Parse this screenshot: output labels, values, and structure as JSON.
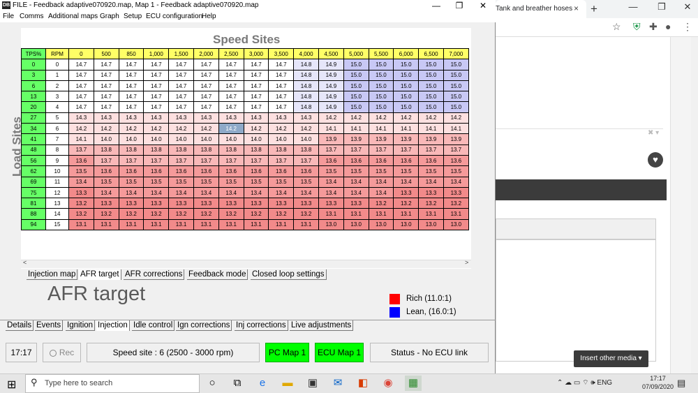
{
  "browser": {
    "tab_title": "Tank and breather hoses lo",
    "tab_close": "×",
    "new_tab": "+",
    "min": "—",
    "max": "❐",
    "close": "✕",
    "insert_media": "Insert other media ▾",
    "dropdown": "✖ ▾"
  },
  "app": {
    "title": "FILE - Feedback adaptive070920.map,  Map 1 - Feedback adaptive070920.map",
    "icon_text": "DB",
    "min": "—",
    "max": "❐",
    "close": "✕",
    "menu": [
      "File",
      "Comms",
      "Additional maps",
      "Graph",
      "Setup",
      "ECU configuration",
      "Help"
    ]
  },
  "map": {
    "speed_title": "Speed Sites",
    "load_title": "Load Sites",
    "corner_x": "TPS%",
    "corner_y": "RPM",
    "rpm_headers": [
      "0",
      "500",
      "850",
      "1,000",
      "1,500",
      "2,000",
      "2,500",
      "3,000",
      "3,500",
      "4,000",
      "4,500",
      "5,000",
      "5,500",
      "6,000",
      "6,500",
      "7,000"
    ],
    "tps": [
      "0",
      "3",
      "6",
      "13",
      "20",
      "27",
      "34",
      "41",
      "48",
      "56",
      "62",
      "69",
      "75",
      "81",
      "88",
      "94"
    ],
    "sites": [
      "0",
      "1",
      "2",
      "3",
      "4",
      "5",
      "6",
      "7",
      "8",
      "9",
      "10",
      "11",
      "12",
      "13",
      "14",
      "15"
    ],
    "values": [
      [
        "14.7",
        "14.7",
        "14.7",
        "14.7",
        "14.7",
        "14.7",
        "14.7",
        "14.7",
        "14.7",
        "14.8",
        "14.9",
        "15.0",
        "15.0",
        "15.0",
        "15.0",
        "15.0"
      ],
      [
        "14.7",
        "14.7",
        "14.7",
        "14.7",
        "14.7",
        "14.7",
        "14.7",
        "14.7",
        "14.7",
        "14.8",
        "14.9",
        "15.0",
        "15.0",
        "15.0",
        "15.0",
        "15.0"
      ],
      [
        "14.7",
        "14.7",
        "14.7",
        "14.7",
        "14.7",
        "14.7",
        "14.7",
        "14.7",
        "14.7",
        "14.8",
        "14.9",
        "15.0",
        "15.0",
        "15.0",
        "15.0",
        "15.0"
      ],
      [
        "14.7",
        "14.7",
        "14.7",
        "14.7",
        "14.7",
        "14.7",
        "14.7",
        "14.7",
        "14.7",
        "14.8",
        "14.9",
        "15.0",
        "15.0",
        "15.0",
        "15.0",
        "15.0"
      ],
      [
        "14.7",
        "14.7",
        "14.7",
        "14.7",
        "14.7",
        "14.7",
        "14.7",
        "14.7",
        "14.7",
        "14.8",
        "14.9",
        "15.0",
        "15.0",
        "15.0",
        "15.0",
        "15.0"
      ],
      [
        "14.3",
        "14.3",
        "14.3",
        "14.3",
        "14.3",
        "14.3",
        "14.3",
        "14.3",
        "14.3",
        "14.3",
        "14.2",
        "14.2",
        "14.2",
        "14.2",
        "14.2",
        "14.2"
      ],
      [
        "14.2",
        "14.2",
        "14.2",
        "14.2",
        "14.2",
        "14.2",
        "14.2",
        "14.2",
        "14.2",
        "14.2",
        "14.1",
        "14.1",
        "14.1",
        "14.1",
        "14.1",
        "14.1"
      ],
      [
        "14.1",
        "14.0",
        "14.0",
        "14.0",
        "14.0",
        "14.0",
        "14.0",
        "14.0",
        "14.0",
        "14.0",
        "13.9",
        "13.9",
        "13.9",
        "13.9",
        "13.9",
        "13.9"
      ],
      [
        "13.7",
        "13.8",
        "13.8",
        "13.8",
        "13.8",
        "13.8",
        "13.8",
        "13.8",
        "13.8",
        "13.8",
        "13.7",
        "13.7",
        "13.7",
        "13.7",
        "13.7",
        "13.7"
      ],
      [
        "13.6",
        "13.7",
        "13.7",
        "13.7",
        "13.7",
        "13.7",
        "13.7",
        "13.7",
        "13.7",
        "13.7",
        "13.6",
        "13.6",
        "13.6",
        "13.6",
        "13.6",
        "13.6"
      ],
      [
        "13.5",
        "13.6",
        "13.6",
        "13.6",
        "13.6",
        "13.6",
        "13.6",
        "13.6",
        "13.6",
        "13.6",
        "13.5",
        "13.5",
        "13.5",
        "13.5",
        "13.5",
        "13.5"
      ],
      [
        "13.4",
        "13.5",
        "13.5",
        "13.5",
        "13.5",
        "13.5",
        "13.5",
        "13.5",
        "13.5",
        "13.5",
        "13.4",
        "13.4",
        "13.4",
        "13.4",
        "13.4",
        "13.4"
      ],
      [
        "13.3",
        "13.4",
        "13.4",
        "13.4",
        "13.4",
        "13.4",
        "13.4",
        "13.4",
        "13.4",
        "13.4",
        "13.4",
        "13.4",
        "13.4",
        "13.3",
        "13.3",
        "13.3"
      ],
      [
        "13.2",
        "13.3",
        "13.3",
        "13.3",
        "13.3",
        "13.3",
        "13.3",
        "13.3",
        "13.3",
        "13.3",
        "13.3",
        "13.3",
        "13.2",
        "13.2",
        "13.2",
        "13.2"
      ],
      [
        "13.2",
        "13.2",
        "13.2",
        "13.2",
        "13.2",
        "13.2",
        "13.2",
        "13.2",
        "13.2",
        "13.2",
        "13.1",
        "13.1",
        "13.1",
        "13.1",
        "13.1",
        "13.1"
      ],
      [
        "13.1",
        "13.1",
        "13.1",
        "13.1",
        "13.1",
        "13.1",
        "13.1",
        "13.1",
        "13.1",
        "13.1",
        "13.0",
        "13.0",
        "13.0",
        "13.0",
        "13.0",
        "13.0"
      ]
    ],
    "selected_row": 6,
    "selected_col": 6,
    "colors": {
      "lean_strong": "#c8c8f5",
      "lean_light": "#e6e6fa",
      "neutral": "#ffffff",
      "rich_light": "#fde0e0",
      "rich_mid": "#f9b8b8",
      "rich_strong": "#f59a9a",
      "rich_max": "#f28a8a",
      "header_x": "#ffff66",
      "header_y": "#66ff66",
      "selected": "#8ea9c8"
    }
  },
  "tabs1": [
    "Injection map",
    "AFR target",
    "AFR corrections",
    "Feedback mode",
    "Closed loop settings"
  ],
  "tabs1_active": 1,
  "afr_title": "AFR target",
  "legend": {
    "rich": "Rich (11.0:1)",
    "lean": "Lean, (16.0:1)"
  },
  "tabs2": [
    "Details",
    "Events",
    "Ignition",
    "Injection",
    "Idle control",
    "Ign corrections",
    "Inj corrections",
    "Live adjustments"
  ],
  "tabs2_active": 3,
  "status": {
    "time": "17:17",
    "rec": "Rec",
    "speed_site": "Speed site : 6 (2500 - 3000 rpm)",
    "pc_map": "PC Map 1",
    "ecu_map": "ECU Map 1",
    "ecu_status": "Status - No ECU link"
  },
  "taskbar": {
    "search_placeholder": "Type here to search",
    "tray": "⌃ ☁ ▭ ⌔ 🕪 ENG",
    "time": "17:17",
    "date": "07/09/2020",
    "notif": "▤"
  }
}
